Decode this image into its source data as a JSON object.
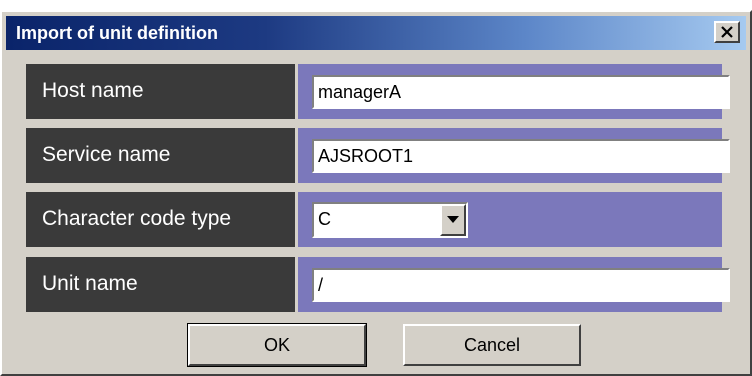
{
  "window": {
    "title": "Import of unit definition",
    "close_glyph": "✕"
  },
  "form": {
    "host_name": {
      "label": "Host name",
      "value": "managerA"
    },
    "service_name": {
      "label": "Service name",
      "value": "AJSROOT1"
    },
    "character_code_type": {
      "label": "Character code type",
      "selected": "C"
    },
    "unit_name": {
      "label": "Unit name",
      "value": "/"
    }
  },
  "buttons": {
    "ok_label": "OK",
    "cancel_label": "Cancel"
  },
  "colors": {
    "label_background": "#3a3a3a",
    "value_background": "#7b78bb",
    "titlebar_start": "#0a246a",
    "titlebar_end": "#a6caf0"
  }
}
